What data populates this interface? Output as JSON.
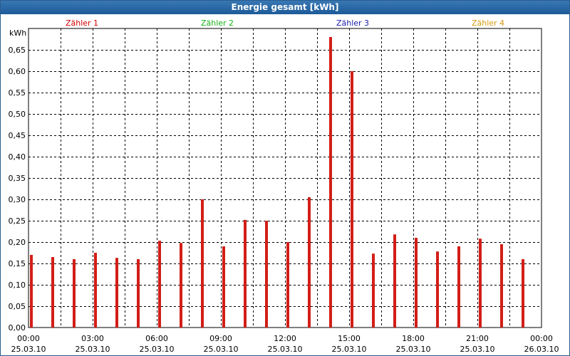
{
  "window": {
    "title": "Energie gesamt [kWh]"
  },
  "colors": {
    "bar": "#d21e17",
    "legend": [
      "#d20000",
      "#1ab01a",
      "#1a1aa8",
      "#d49a10"
    ],
    "grid": "#000000"
  },
  "chart_data": {
    "type": "bar",
    "title": "Energie gesamt [kWh]",
    "ylabel": "kWh",
    "xlabel": "",
    "ylim": [
      0,
      0.7
    ],
    "y_ticks": [
      "0,00",
      "0,05",
      "0,10",
      "0,15",
      "0,20",
      "0,25",
      "0,30",
      "0,35",
      "0,40",
      "0,45",
      "0,50",
      "0,55",
      "0,60",
      "0,65"
    ],
    "x_ticks": [
      {
        "time": "00:00",
        "date": "25.03.10"
      },
      {
        "time": "03:00",
        "date": "25.03.10"
      },
      {
        "time": "06:00",
        "date": "25.03.10"
      },
      {
        "time": "09:00",
        "date": "25.03.10"
      },
      {
        "time": "12:00",
        "date": "25.03.10"
      },
      {
        "time": "15:00",
        "date": "25.03.10"
      },
      {
        "time": "18:00",
        "date": "25.03.10"
      },
      {
        "time": "21:00",
        "date": "25.03.10"
      },
      {
        "time": "00:00",
        "date": "26.03.10"
      }
    ],
    "legend": [
      "Zähler 1",
      "Zähler 2",
      "Zähler 3",
      "Zähler 4"
    ],
    "legend_placement": "top",
    "grid": true,
    "series": [
      {
        "x_hours": [
          0,
          1,
          2,
          3,
          4,
          5,
          6,
          7,
          8,
          9,
          10,
          11,
          12,
          13,
          14,
          15,
          16,
          17,
          18,
          19,
          20,
          21,
          22,
          23
        ],
        "values": [
          0.17,
          0.165,
          0.16,
          0.175,
          0.163,
          0.16,
          0.203,
          0.198,
          0.3,
          0.19,
          0.252,
          0.25,
          0.2,
          0.305,
          0.68,
          0.6,
          0.173,
          0.218,
          0.21,
          0.178,
          0.19,
          0.208,
          0.195,
          0.16
        ]
      }
    ]
  }
}
